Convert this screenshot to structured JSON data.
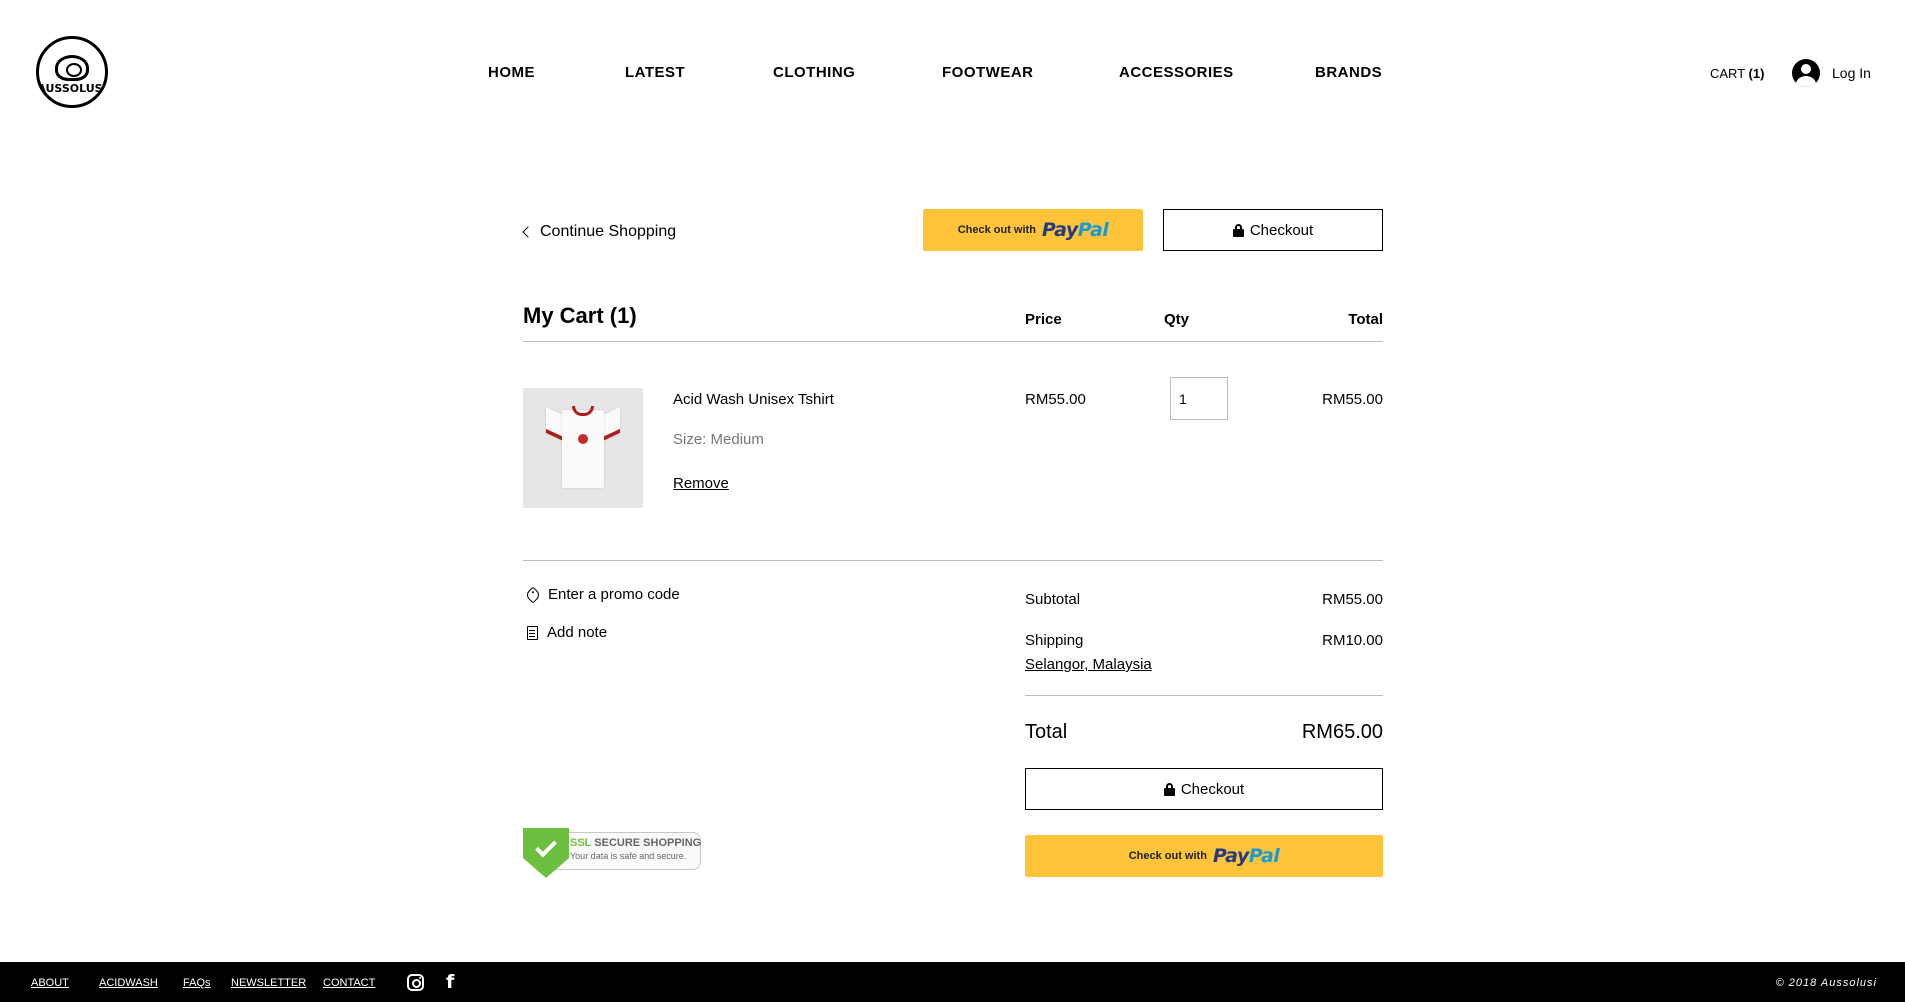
{
  "brand": {
    "logo_text": "AUSSOLUSI"
  },
  "nav": {
    "items": [
      {
        "label": "HOME"
      },
      {
        "label": "LATEST"
      },
      {
        "label": "CLOTHING"
      },
      {
        "label": "FOOTWEAR"
      },
      {
        "label": "ACCESSORIES"
      },
      {
        "label": "BRANDS"
      }
    ],
    "cart_label": "CART",
    "cart_count": "(1)",
    "login_label": "Log In"
  },
  "cart": {
    "continue_label": "Continue Shopping",
    "paypal_prefix": "Check out with",
    "paypal_logo_a": "Pay",
    "paypal_logo_b": "Pal",
    "checkout_label": "Checkout",
    "title": "My Cart (1)",
    "columns": {
      "price": "Price",
      "qty": "Qty",
      "total": "Total"
    },
    "items": [
      {
        "name": "Acid Wash Unisex Tshirt",
        "size": "Size: Medium",
        "remove": "Remove",
        "price": "RM55.00",
        "qty": "1",
        "total": "RM55.00"
      }
    ],
    "promo_label": "Enter a promo code",
    "note_label": "Add note",
    "summary": {
      "subtotal_label": "Subtotal",
      "subtotal": "RM55.00",
      "shipping_label": "Shipping",
      "shipping": "RM10.00",
      "shipping_location": "Selangor, Malaysia",
      "total_label": "Total",
      "total": "RM65.00"
    },
    "ssl": {
      "title_a": "SSL",
      "title_b": "SECURE SHOPPING",
      "subtitle": "Your data is safe and secure."
    }
  },
  "footer": {
    "links": [
      {
        "label": "ABOUT"
      },
      {
        "label": "ACIDWASH"
      },
      {
        "label": "FAQs"
      },
      {
        "label": "NEWSLETTER"
      },
      {
        "label": "CONTACT"
      }
    ],
    "facebook_glyph": "f",
    "copyright": "© 2018 Aussolusi"
  },
  "colors": {
    "paypal_yellow": "#ffc439",
    "paypal_dark_blue": "#253b80",
    "paypal_light_blue": "#179bd7",
    "ssl_green": "#6cbf3f",
    "footer_bg": "#000000",
    "shirt_trim": "#b01c1c"
  }
}
